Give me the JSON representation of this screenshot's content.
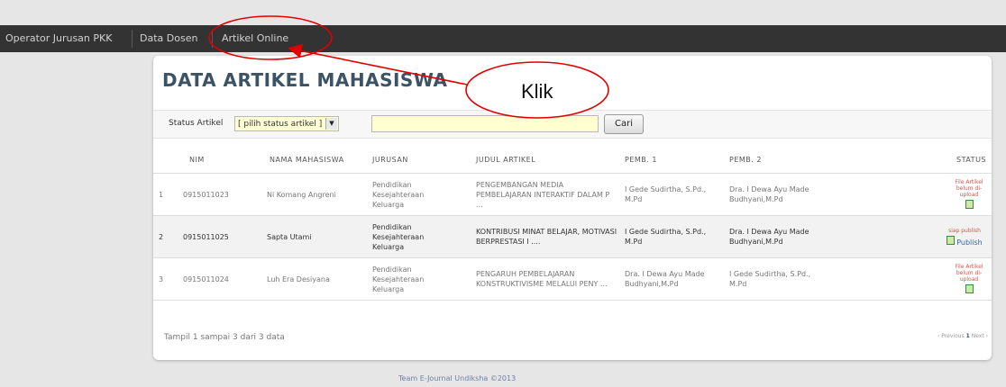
{
  "nav": {
    "items": [
      "Operator Jurusan PKK",
      "Data Dosen",
      "Artikel Online"
    ]
  },
  "page": {
    "title": "DATA ARTIKEL MAHASISWA"
  },
  "filter": {
    "label": "Status Artikel",
    "select_value": "[ pilih status artikel ]",
    "search_value": "",
    "button": "Cari"
  },
  "table": {
    "columns": [
      "NIM",
      "NAMA MAHASISWA",
      "JURUSAN",
      "JUDUL ARTIKEL",
      "PEMB. 1",
      "PEMB. 2",
      "STATUS"
    ],
    "rows": [
      {
        "no": "1",
        "nim": "0915011023",
        "nama": "Ni Komang Angreni",
        "jurusan": "Pendidikan Kesejahteraan Keluarga",
        "judul": "PENGEMBANGAN MEDIA PEMBELAJARAN INTERAKTIF DALAM P ...",
        "pemb1": "I Gede Sudirtha, S.Pd., M.Pd",
        "pemb2": "Dra. I Dewa Ayu Made Budhyani,M.Pd",
        "status": "File Artikel belum di-upload"
      },
      {
        "no": "2",
        "nim": "0915011025",
        "nama": "Sapta Utami",
        "jurusan": "Pendidikan Kesejahteraan Keluarga",
        "judul": "KONTRIBUSI MINAT BELAJAR, MOTIVASI BERPRESTASI I ....",
        "pemb1": "I Gede Sudirtha, S.Pd., M.Pd",
        "pemb2": "Dra. I Dewa Ayu Made Budhyani,M.Pd",
        "status": "siap publish",
        "status_link": "Publish"
      },
      {
        "no": "3",
        "nim": "0915011024",
        "nama": "Luh Era Desiyana",
        "jurusan": "Pendidikan Kesejahteraan Keluarga",
        "judul": "PENGARUH PEMBELAJARAN KONSTRUKTIVISME MELALUI PENY ...",
        "pemb1": "Dra. I Dewa Ayu Made Budhyani,M.Pd",
        "pemb2": "I Gede Sudirtha, S.Pd., M.Pd",
        "status": "File Artikel belum di-upload"
      }
    ]
  },
  "table_info": "Tampil 1 sampai 3 dari 3 data",
  "pagination": {
    "prev": "‹ Previous",
    "current": "1",
    "next": "Next ›"
  },
  "footer": {
    "copyright": "Team E-Journal Undiksha ©2013"
  },
  "annotation": {
    "callout": "Klik",
    "color": "#e00000"
  }
}
